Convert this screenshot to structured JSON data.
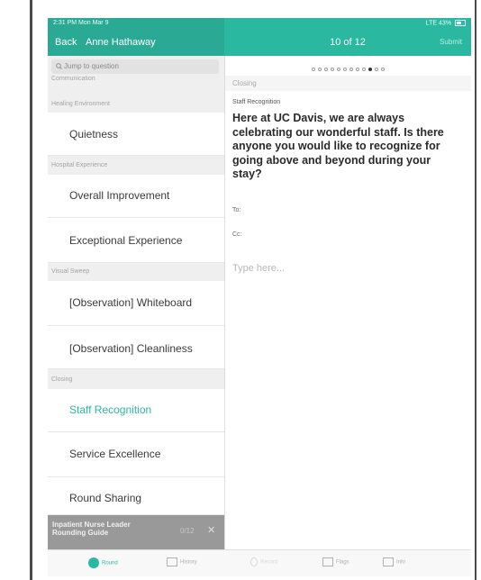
{
  "status_bar": {
    "time": "2:31 PM  Mon Mar 9",
    "signal": "LTE",
    "battery": "43%"
  },
  "header": {
    "back_label": "Back",
    "patient_name": "Anne Hathaway",
    "progress": "10 of 12",
    "submit_label": "Submit"
  },
  "sidebar": {
    "search_placeholder": "Jump to question",
    "sections": {
      "communication": "Communication",
      "healing_environment": "Healing Environment",
      "hospital_experience": "Hospital Experience",
      "visual_sweep": "Visual Sweep",
      "closing": "Closing"
    },
    "items": {
      "quietness": "Quietness",
      "overall_improvement": "Overall Improvement",
      "exceptional_experience": "Exceptional Experience",
      "observation_whiteboard": "[Observation] Whiteboard",
      "observation_cleanliness": "[Observation] Cleanliness",
      "staff_recognition": "Staff Recognition",
      "service_excellence": "Service Excellence",
      "round_sharing": "Round Sharing"
    },
    "footer": {
      "guide_title_line1": "Inpatient Nurse Leader",
      "guide_title_line2": "Rounding Guide",
      "count": "0/12"
    }
  },
  "question": {
    "section": "Closing",
    "label": "Staff Recognition",
    "text": "Here at UC Davis, we are always celebrating our wonderful staff. Is there anyone you would like to recognize for going above and beyond during your stay?",
    "to_label": "To:",
    "cc_label": "Cc:",
    "input_placeholder": "Type here...",
    "dots_total": 12,
    "dot_current": 10
  },
  "tabs": {
    "round": "Round",
    "history": "History",
    "record": "Record",
    "flags": "Flags",
    "info": "Info"
  },
  "colors": {
    "accent": "#2bb8a0",
    "header_left": "#2aa994",
    "footer_gray": "#999999"
  }
}
